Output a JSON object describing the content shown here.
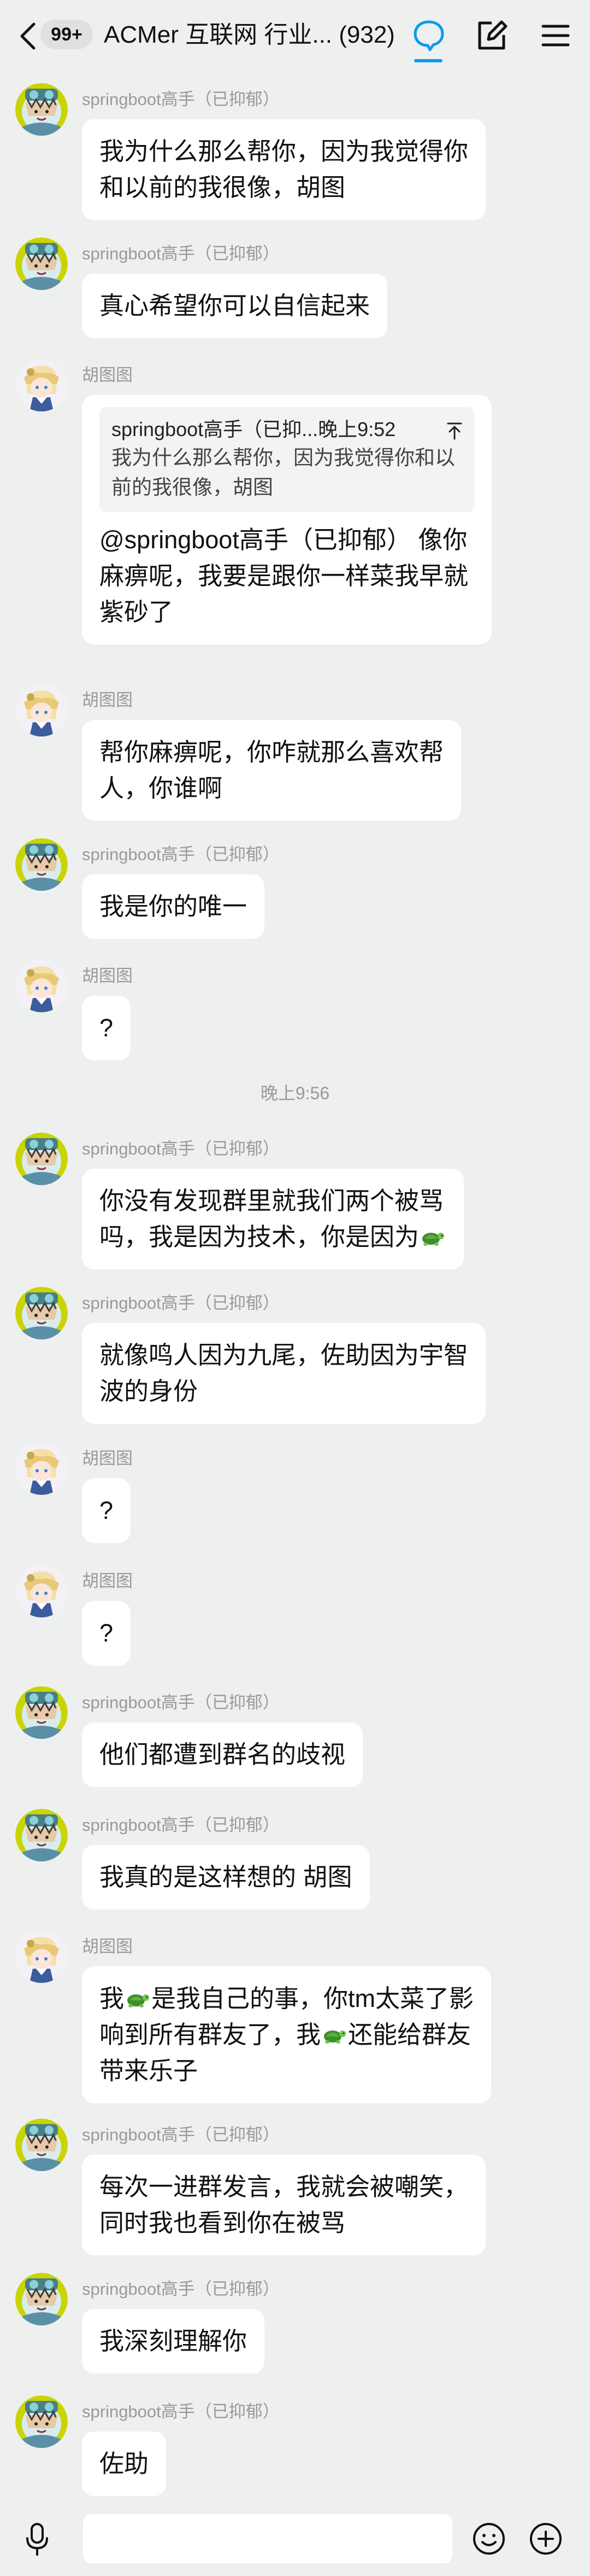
{
  "header": {
    "badge": "99+",
    "title": "ACMer 互联网 行业... (932)"
  },
  "users": {
    "a": "springboot高手（已抑郁）",
    "b": "胡图图"
  },
  "messages": [
    {
      "sender": "springboot高手（已抑郁）",
      "lines": [
        "我为什么那么帮你，因为我觉得你",
        "和以前的我很像，胡图"
      ]
    },
    {
      "sender": "springboot高手（已抑郁）",
      "lines": [
        "真心希望你可以自信起来"
      ]
    },
    {
      "sender": "胡图图",
      "quote": {
        "head": "springboot高手（已抑...晚上9:52",
        "lines": [
          "我为什么那么帮你，因为我觉得你和以",
          "前的我很像，胡图"
        ]
      },
      "lines": [
        "@springboot高手（已抑郁） 像你",
        "麻痹呢，我要是跟你一样菜我早就",
        "紫砂了"
      ]
    },
    {
      "sender": "胡图图",
      "lines": [
        "帮你麻痹呢，你咋就那么喜欢帮",
        "人，你谁啊"
      ]
    },
    {
      "sender": "springboot高手（已抑郁）",
      "lines": [
        "我是你的唯一"
      ]
    },
    {
      "sender": "胡图图",
      "lines": [
        "?"
      ]
    },
    {
      "sender": "springboot高手（已抑郁）",
      "lines": [
        "你没有发现群里就我们两个被骂",
        "吗，我是因为技术，你是因为"
      ]
    },
    {
      "sender": "springboot高手（已抑郁）",
      "lines": [
        "就像鸣人因为九尾，佐助因为宇智",
        "波的身份"
      ]
    },
    {
      "sender": "胡图图",
      "lines": [
        "?"
      ]
    },
    {
      "sender": "胡图图",
      "lines": [
        "?"
      ]
    },
    {
      "sender": "springboot高手（已抑郁）",
      "lines": [
        "他们都遭到群名的歧视"
      ]
    },
    {
      "sender": "springboot高手（已抑郁）",
      "lines": [
        "我真的是这样想的 胡图"
      ]
    },
    {
      "sender": "胡图图",
      "lines": [
        "我",
        "是我自己的事，你tm太菜了影",
        "响到所有群友了，我",
        "还能给群友",
        "带来乐子"
      ]
    },
    {
      "sender": "springboot高手（已抑郁）",
      "lines": [
        "每次一进群发言，我就会被嘲笑，",
        "同时我也看到你在被骂"
      ]
    },
    {
      "sender": "springboot高手（已抑郁）",
      "lines": [
        "我深刻理解你"
      ]
    },
    {
      "sender": "springboot高手（已抑郁）",
      "lines": [
        "佐助"
      ]
    }
  ],
  "time_separator": "晚上9:56",
  "icons": {
    "back": "chevron-left-icon",
    "chat": "chat-bubble-icon",
    "edit": "edit-icon",
    "menu": "menu-icon",
    "mic": "microphone-icon",
    "emoji": "smiley-icon",
    "plus": "plus-circle-icon",
    "pin": "pin-icon",
    "turtle": "turtle-emoji"
  },
  "colors": {
    "accent": "#0a9bf0",
    "background": "#eef0ef",
    "bubble": "#ffffff"
  }
}
